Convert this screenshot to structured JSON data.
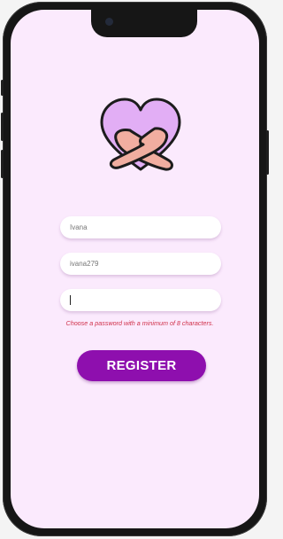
{
  "form": {
    "name_value": "Ivana",
    "username_value": "ivana279",
    "password_value": "",
    "password_hint": "Choose a password with a minimum of 8 characters.",
    "register_label": "REGISTER"
  },
  "colors": {
    "screen_bg": "#fbeafd",
    "heart_fill": "#e2aef5",
    "arms_fill": "#f1aea0",
    "accent": "#8e0fae",
    "hint_text": "#d0304a"
  },
  "icons": {
    "logo": "heart-hug-icon"
  }
}
